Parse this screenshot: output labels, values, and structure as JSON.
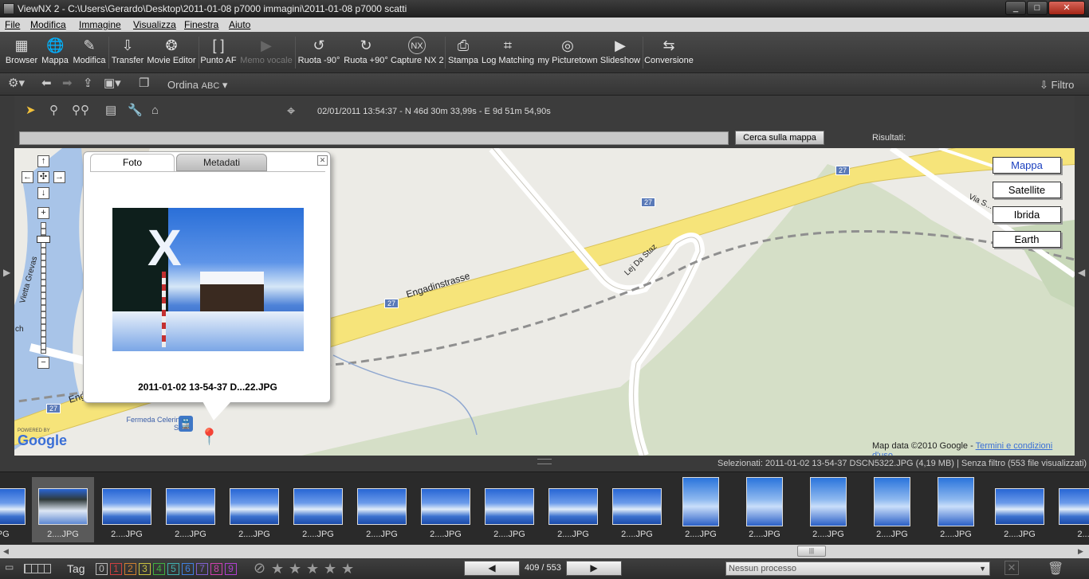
{
  "window": {
    "title": "ViewNX 2 - C:\\Users\\Gerardo\\Desktop\\2011-01-08 p7000 immagini\\2011-01-08 p7000 scatti",
    "minimize": "_",
    "maximize": "□",
    "close": "✕"
  },
  "menu": [
    "File",
    "Modifica",
    "Immagine",
    "Visualizza",
    "Finestra",
    "Aiuto"
  ],
  "toolbar": [
    {
      "label": "Browser",
      "icon": "▦"
    },
    {
      "label": "Mappa",
      "icon": "🌐"
    },
    {
      "label": "Modifica",
      "icon": "✎"
    },
    {
      "label": "Transfer",
      "icon": "⇩"
    },
    {
      "label": "Movie Editor",
      "icon": "❂"
    },
    {
      "label": "Punto AF",
      "icon": "[ ]"
    },
    {
      "label": "Memo vocale",
      "icon": "▶"
    },
    {
      "label": "Ruota -90°",
      "icon": "↺"
    },
    {
      "label": "Ruota +90°",
      "icon": "↻"
    },
    {
      "label": "Capture NX 2",
      "icon": "NX"
    },
    {
      "label": "Stampa",
      "icon": "⎙"
    },
    {
      "label": "Log Matching",
      "icon": "⌗"
    },
    {
      "label": "my Picturetown",
      "icon": "◎"
    },
    {
      "label": "Slideshow",
      "icon": "▶"
    },
    {
      "label": "Conversione",
      "icon": "⇆"
    }
  ],
  "navbar": {
    "sort_label": "Ordina",
    "sort_value": "ABC",
    "filter_label": "Filtro"
  },
  "maptools": {
    "coords": "02/01/2011 13:54:37 - N 46d 30m 33,99s - E 9d 51m 54,90s"
  },
  "search": {
    "button": "Cerca sulla mappa",
    "results_label": "Risultati:",
    "value": ""
  },
  "map": {
    "types": [
      "Mappa",
      "Satellite",
      "Ibrida",
      "Earth"
    ],
    "labels": {
      "road1": "Engadinstrasse",
      "road2": "Lej Da Staz",
      "road3": "Via S...",
      "road4": "Vietta Grevas",
      "road_num": "27",
      "station": "Fermeda Celerina - Staz",
      "partial": "ch",
      "partial2": "Eng"
    },
    "attribution": "Map data ©2010 Google - ",
    "terms": "Termini e condizioni d'uso",
    "powered": "POWERED BY",
    "google": "Google"
  },
  "popup": {
    "tabs": [
      "Foto",
      "Metadati"
    ],
    "caption": "2011-01-02 13-54-37 D...22.JPG",
    "close": "✕"
  },
  "status": "Selezionati: 2011-01-02 13-54-37 DSCN5322.JPG (4,19 MB) | Senza filtro   (553 file visualizzati)",
  "thumbs": [
    "JPG",
    "2....JPG",
    "2....JPG",
    "2....JPG",
    "2....JPG",
    "2....JPG",
    "2....JPG",
    "2....JPG",
    "2....JPG",
    "2....JPG",
    "2....JPG",
    "2....JPG",
    "2....JPG",
    "2....JPG",
    "2....JPG",
    "2....JPG",
    "2....JPG",
    "2..."
  ],
  "bottom": {
    "tag_label": "Tag",
    "tags": [
      "0",
      "1",
      "2",
      "3",
      "4",
      "5",
      "6",
      "7",
      "8",
      "9"
    ],
    "tag_colors": [
      "#bbbbbb",
      "#d04040",
      "#d08030",
      "#c8c040",
      "#40b040",
      "#40b0b0",
      "#4080e0",
      "#8060d0",
      "#d040b0",
      "#b040d0"
    ],
    "page": "409 / 553",
    "process": "Nessun processo"
  }
}
